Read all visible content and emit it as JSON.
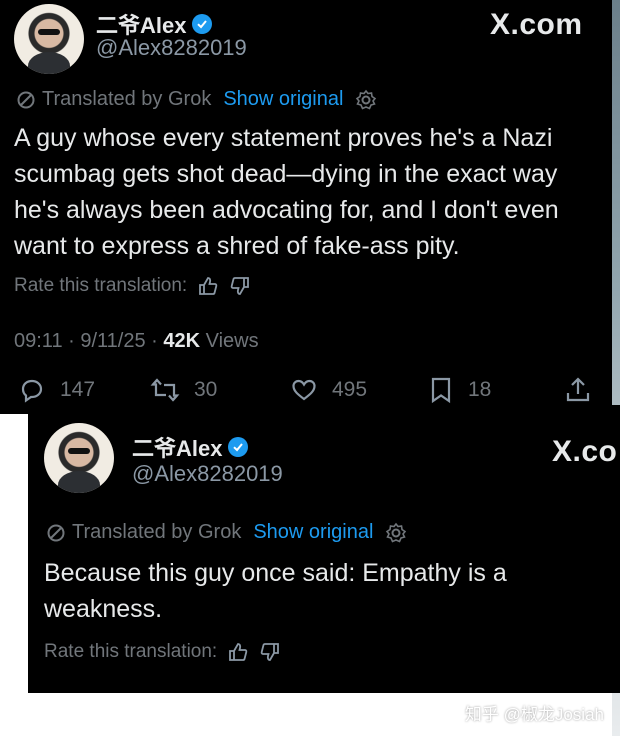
{
  "tweet1": {
    "display_name": "二爷Alex",
    "handle": "@Alex8282019",
    "brand": "X.com",
    "translated_by": "Translated by Grok",
    "show_original": "Show original",
    "text": "A guy whose every statement proves he's a Nazi scumbag gets shot dead—dying in the exact way he's always been advocating for, and I don't even want to express a shred of fake-ass pity.",
    "rate_label": "Rate this translation:",
    "timestamp": "09:11 · 9/11/25 · ",
    "views_count": "42K",
    "views_label": " Views",
    "actions": {
      "replies": "147",
      "reposts": "30",
      "likes": "495",
      "bookmarks": "18"
    }
  },
  "tweet2": {
    "display_name": "二爷Alex",
    "handle": "@Alex8282019",
    "brand": "X.co",
    "translated_by": "Translated by Grok",
    "show_original": "Show original",
    "text": "Because this guy once said: Empathy is a weakness.",
    "rate_label": "Rate this translation:"
  },
  "watermark": "知乎 @椒龙Josiah",
  "colors": {
    "background": "#000000",
    "text": "#e7e9ea",
    "muted": "#71767b",
    "accent": "#1d9bf0"
  },
  "icons": [
    "verified-badge-icon",
    "translate-icon",
    "gear-icon",
    "thumbs-up-icon",
    "thumbs-down-icon",
    "reply-icon",
    "repost-icon",
    "like-icon",
    "bookmark-icon",
    "share-icon"
  ]
}
